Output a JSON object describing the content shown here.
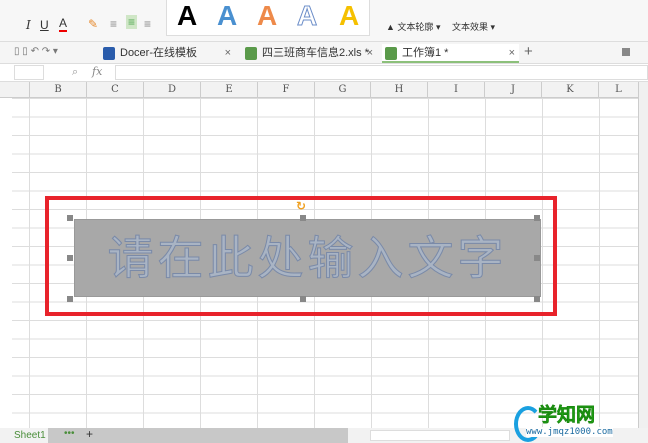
{
  "ribbon": {
    "italic": "I",
    "underline": "U",
    "font_color": "A",
    "text_outline": "文本轮廓",
    "text_effect": "文本效果",
    "style_letters": [
      "A",
      "A",
      "A",
      "A",
      "A"
    ]
  },
  "tabs": [
    {
      "label": "Docer-在线模板"
    },
    {
      "label": "四三班商车信息2.xls *"
    },
    {
      "label": "工作簿1 *",
      "active": true
    }
  ],
  "formula_bar": {
    "fx": "fx",
    "value": ""
  },
  "columns": [
    "B",
    "C",
    "D",
    "E",
    "F",
    "G",
    "H",
    "I",
    "J",
    "K",
    "L"
  ],
  "wordart": {
    "text": "请在此处输入文字"
  },
  "sheets": [
    {
      "label": "Sheet1"
    }
  ],
  "watermark": {
    "title": "学知网",
    "url": "www.jmqz1000.com"
  }
}
